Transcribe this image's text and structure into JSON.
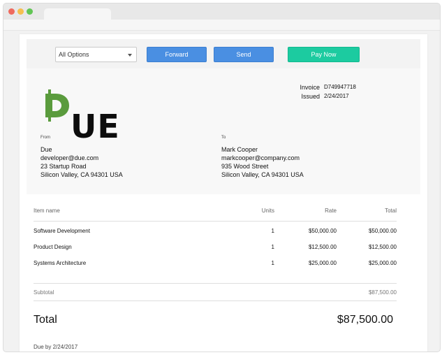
{
  "browser": {
    "traffic_lights": [
      "close",
      "minimize",
      "maximize"
    ]
  },
  "actions": {
    "select_value": "All Options",
    "forward_label": "Forward",
    "send_label": "Send",
    "pay_label": "Pay Now"
  },
  "brand": {
    "logo_text": "UE",
    "logo_color": "#5a9b3d"
  },
  "invoice": {
    "invoice_label": "Invoice",
    "invoice_number": "D749947718",
    "issued_label": "Issued",
    "issued_date": "2/24/2017"
  },
  "from": {
    "label": "From",
    "name": "Due",
    "email": "developer@due.com",
    "street": "23 Startup Road",
    "city": "Silicon Valley, CA 94301 USA"
  },
  "to": {
    "label": "To",
    "name": "Mark Cooper",
    "email": "markcooper@company.com",
    "street": "935 Wood Street",
    "city": "Silicon Valley, CA 94301 USA"
  },
  "table": {
    "headers": [
      "Item name",
      "Units",
      "Rate",
      "Total"
    ],
    "rows": [
      {
        "name": "Software Development",
        "units": "1",
        "rate": "$50,000.00",
        "total": "$50,000.00"
      },
      {
        "name": "Product Design",
        "units": "1",
        "rate": "$12,500.00",
        "total": "$12,500.00"
      },
      {
        "name": "Systems Architecture",
        "units": "1",
        "rate": "$25,000.00",
        "total": "$25,000.00"
      }
    ]
  },
  "summary": {
    "subtotal_label": "Subtotal",
    "subtotal_value": "$87,500.00",
    "total_label": "Total",
    "total_value": "$87,500.00",
    "due_text": "Due by 2/24/2017"
  },
  "colors": {
    "accent_blue": "#4a8fe2",
    "accent_green": "#1ccba0"
  }
}
